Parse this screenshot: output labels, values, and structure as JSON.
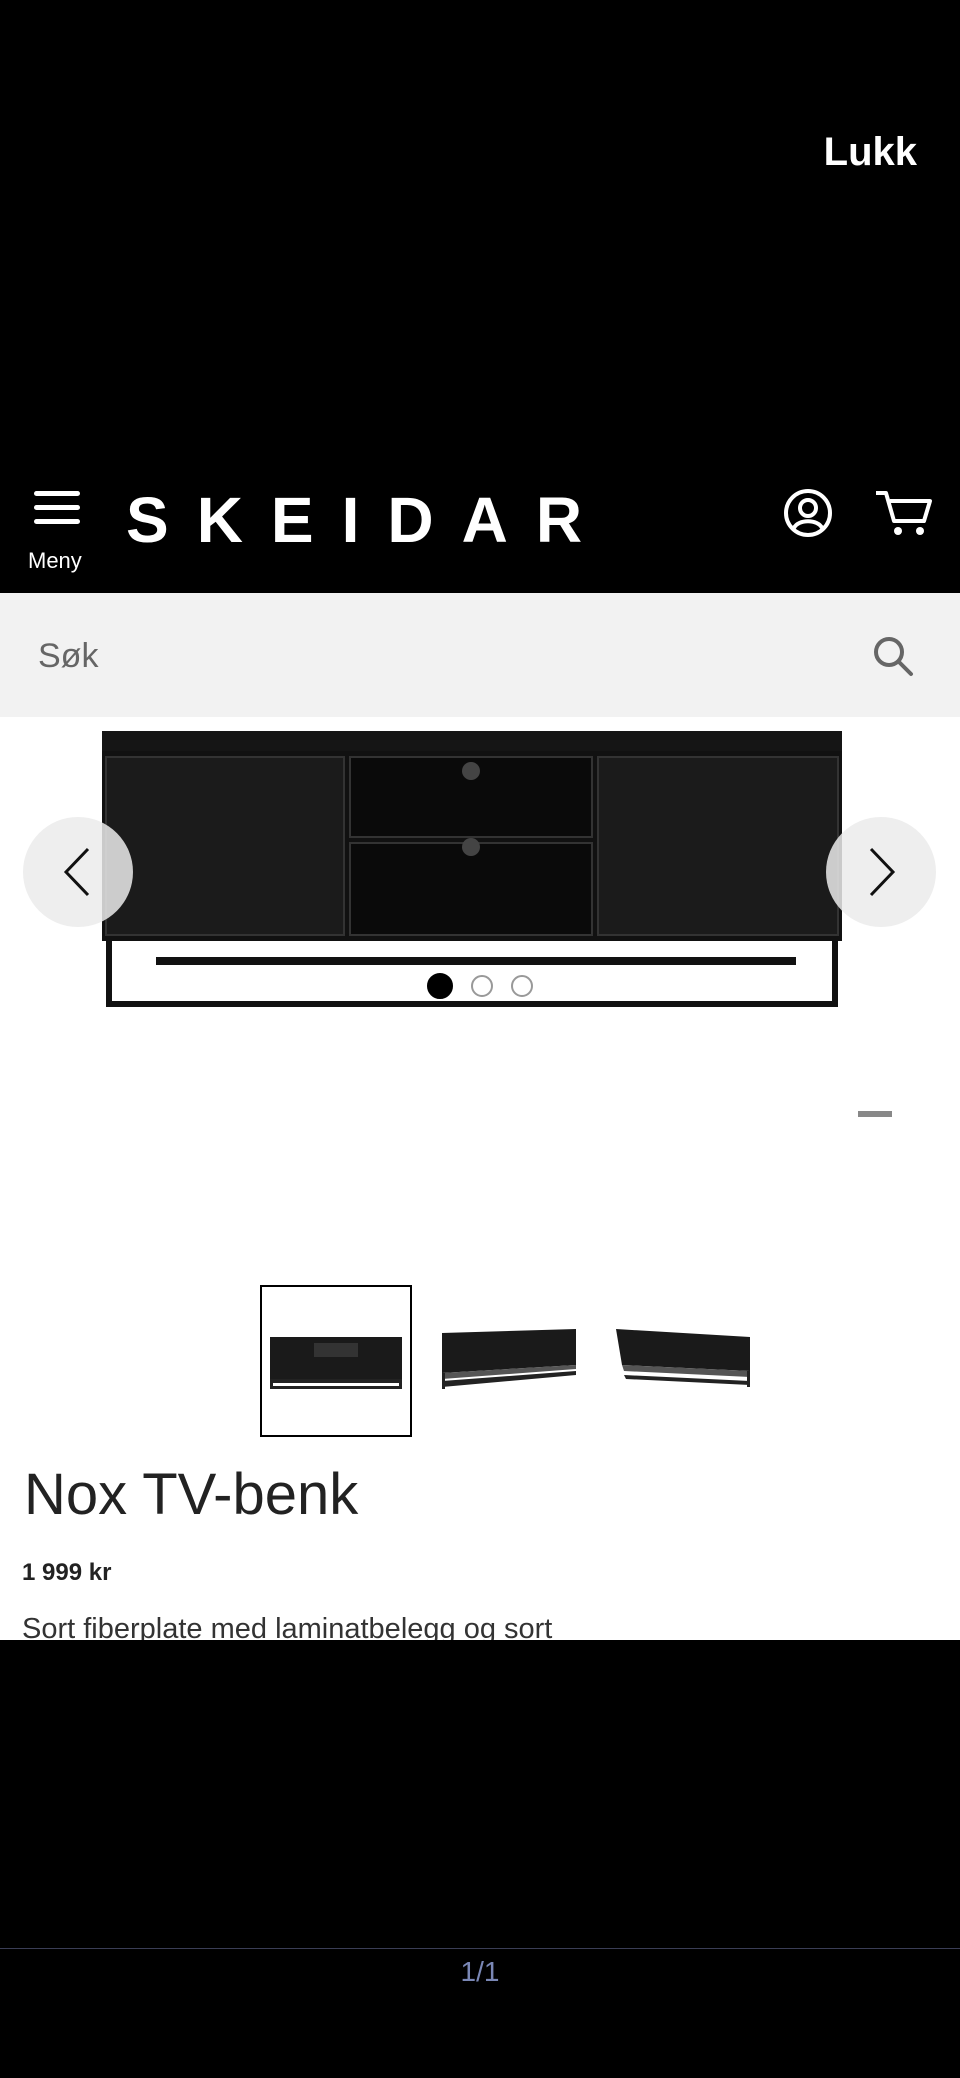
{
  "overlay": {
    "close_label": "Lukk",
    "page_indicator": "1/1"
  },
  "header": {
    "menu_label": "Meny",
    "logo_text": "SKEIDAR"
  },
  "search": {
    "placeholder": "Søk"
  },
  "gallery": {
    "slide_count": 3,
    "active_slide": 1,
    "thumbnail_count": 3
  },
  "product": {
    "title": "Nox TV-benk",
    "price": "1 999 kr",
    "description": "Sort fiberplate med laminatbelegg og sort"
  },
  "colors": {
    "background": "#000000",
    "accent": "#000000",
    "search_bg": "#f2f2f2",
    "pager_text": "#7a87b5"
  }
}
